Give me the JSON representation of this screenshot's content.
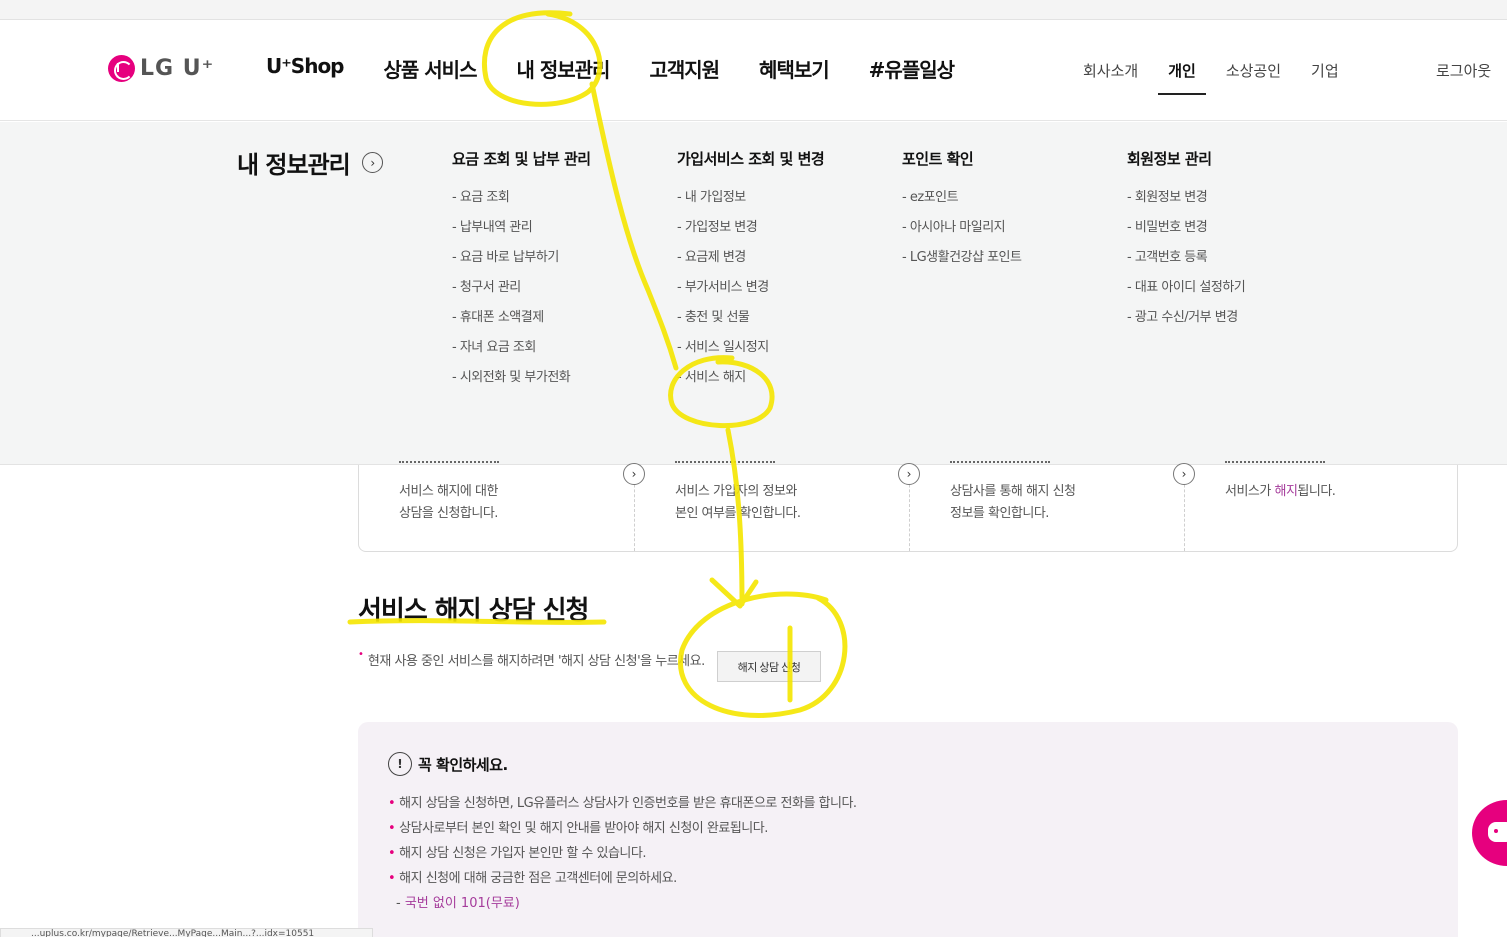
{
  "brand": {
    "logo_text": "LG U⁺",
    "accent": "#e6007e"
  },
  "gnb": [
    "U⁺Shop",
    "상품 서비스",
    "내 정보관리",
    "고객지원",
    "혜택보기",
    "#유플일상"
  ],
  "util": [
    "회사소개",
    "개인",
    "소상공인",
    "기업"
  ],
  "util_active": "개인",
  "logout": "로그아웃",
  "mega": {
    "title": "내 정보관리",
    "columns": [
      {
        "title": "요금 조회 및 납부 관리",
        "items": [
          "요금 조회",
          "납부내역 관리",
          "요금 바로 납부하기",
          "청구서 관리",
          "휴대폰 소액결제",
          "자녀 요금 조회",
          "시외전화 및 부가전화"
        ]
      },
      {
        "title": "가입서비스 조회 및 변경",
        "items": [
          "내 가입정보",
          "가입정보 변경",
          "요금제 변경",
          "부가서비스 변경",
          "충전 및 선물",
          "서비스 일시정지",
          "서비스 해지"
        ]
      },
      {
        "title": "포인트 확인",
        "items": [
          "ez포인트",
          "아시아나 마일리지",
          "LG생활건강샵 포인트"
        ]
      },
      {
        "title": "회원정보 관리",
        "items": [
          "회원정보 변경",
          "비밀번호 변경",
          "고객번호 등록",
          "대표 아이디 설정하기",
          "광고 수신/거부 변경"
        ]
      }
    ]
  },
  "steps": [
    {
      "line1": "서비스 해지에 대한",
      "line2": "상담을 신청합니다."
    },
    {
      "line1": "서비스 가입자의 정보와",
      "line2": "본인 여부를 확인합니다."
    },
    {
      "line1": "상담사를 통해 해지 신청",
      "line2": "정보를 확인합니다."
    },
    {
      "line1_pre": "서비스가 ",
      "line1_hl": "해지",
      "line1_post": "됩니다."
    }
  ],
  "section": {
    "title": "서비스 해지 상담 신청",
    "notice": "현재 사용 중인 서비스를 해지하려면 '해지 상담 신청'을 누르세요.",
    "button": "해지 상담 신청"
  },
  "info": {
    "title": "꼭 확인하세요.",
    "items": [
      "해지 상담을 신청하면, LG유플러스 상담사가 인증번호를 받은 휴대폰으로 전화를 합니다.",
      "상담사로부터 본인 확인 및 해지 안내를 받아야 해지 신청이 완료됩니다.",
      "해지 상담 신청은 가입자 본인만 할 수 있습니다.",
      "해지 신청에 대해 궁금한 점은 고객센터에 문의하세요."
    ],
    "sub": "국번 없이 101(무료)"
  },
  "statusbar": "...uplus.co.kr/mypage/Retrieve...MyPage...Main...?...idx=10551",
  "icons": {
    "chevron": "chevron-right-icon",
    "bulb": "lightbulb-icon",
    "chat": "chatbot-icon"
  },
  "annotation_color": "#f5e600"
}
